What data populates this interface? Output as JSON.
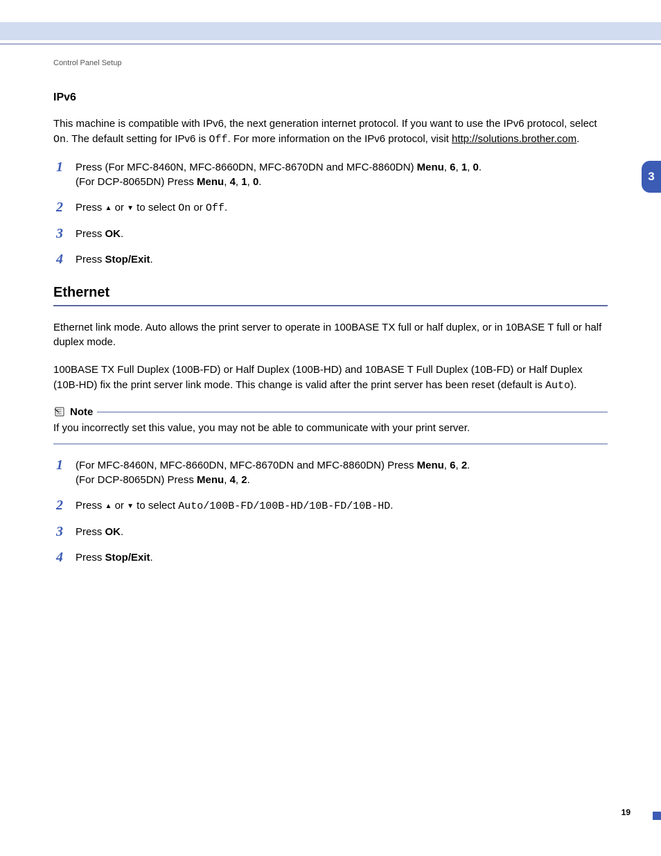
{
  "header": {
    "breadcrumb": "Control Panel Setup"
  },
  "side": {
    "chapter": "3"
  },
  "ipv6": {
    "title": "IPv6",
    "intro_a": "This machine is compatible with IPv6, the next generation internet protocol. If you want to use the IPv6 protocol, select ",
    "intro_on": "On",
    "intro_b": ". The default setting for IPv6 is ",
    "intro_off": "Off",
    "intro_c": ".  For more information on the IPv6 protocol, visit ",
    "link": "http://solutions.brother.com",
    "intro_d": ".",
    "steps": {
      "s1a": "Press (For MFC-8460N, MFC-8660DN, MFC-8670DN and MFC-8860DN) ",
      "s1_menu": "Menu",
      "s1_sep": ", ",
      "s1_6": "6",
      "s1_1": "1",
      "s1_0": "0",
      "s1_dot": ".",
      "s1b": "(For DCP-8065DN) Press ",
      "s1b_menu": "Menu",
      "s1b_4": "4",
      "s1b_1": "1",
      "s1b_0": "0",
      "s2a": "Press ",
      "s2b": " or ",
      "s2c": " to select ",
      "s2_on": "On",
      "s2_or": " or ",
      "s2_off": "Off",
      "s2_dot": ".",
      "s3a": "Press ",
      "s3_ok": "OK",
      "s3_dot": ".",
      "s4a": "Press ",
      "s4_se": "Stop/Exit",
      "s4_dot": "."
    }
  },
  "eth": {
    "title": "Ethernet",
    "p1": "Ethernet link mode. Auto allows the print server to operate in 100BASE TX full or half duplex, or in 10BASE T full or half duplex mode.",
    "p2a": "100BASE TX Full Duplex (100B-FD) or Half Duplex (100B-HD) and 10BASE T Full Duplex (10B-FD) or Half Duplex (10B-HD) fix the print server link mode. This change is valid after the print server has been reset (default is ",
    "p2_auto": "Auto",
    "p2b": ").",
    "note_label": "Note",
    "note_text": "If you incorrectly set this value, you may not be able to communicate with your print server.",
    "steps": {
      "s1a": "(For MFC-8460N, MFC-8660DN, MFC-8670DN and MFC-8860DN) Press ",
      "s1_menu": "Menu",
      "s1_sep": ", ",
      "s1_6": "6",
      "s1_2": "2",
      "s1_dot": ".",
      "s1b": "(For DCP-8065DN) Press ",
      "s1b_menu": "Menu",
      "s1b_4": "4",
      "s1b_2": "2",
      "s2a": "Press ",
      "s2b": " or ",
      "s2c": " to select ",
      "s2_opts": "Auto/100B-FD/100B-HD/10B-FD/10B-HD",
      "s2_dot": ".",
      "s3a": "Press ",
      "s3_ok": "OK",
      "s3_dot": ".",
      "s4a": "Press ",
      "s4_se": "Stop/Exit",
      "s4_dot": "."
    }
  },
  "footer": {
    "page": "19"
  }
}
